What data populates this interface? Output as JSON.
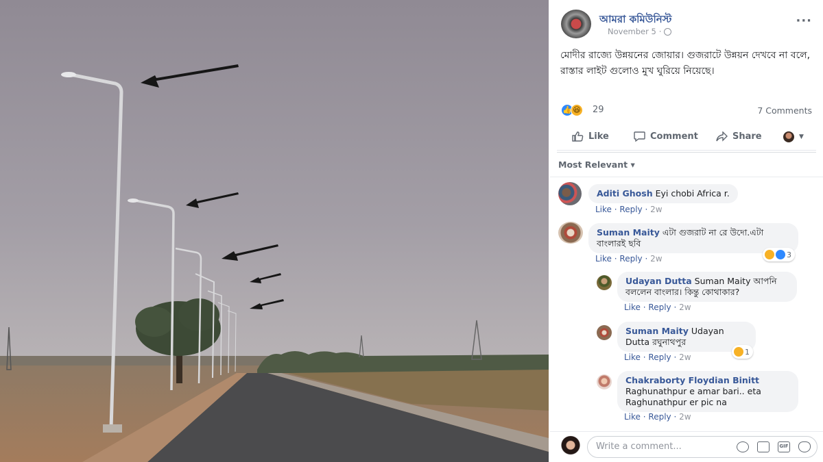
{
  "post": {
    "page_name": "আমরা কমিউনিস্ট",
    "date": "November 5",
    "text": "মোদীর রাজ্যে উন্নয়নের জোয়ার। গুজরাটে উন্নয়ন দেখবে না বলে, রাস্তার লাইট গুলোও মুখ ঘুরিয়ে নিয়েছে।",
    "reaction_count": "29",
    "comments_count": "7 Comments",
    "reaction_types": [
      "like",
      "haha"
    ]
  },
  "actions": {
    "like": "Like",
    "comment": "Comment",
    "share": "Share"
  },
  "filter": {
    "label": "Most Relevant ▾"
  },
  "comments": [
    {
      "author": "Aditi Ghosh",
      "text": "Eyi chobi Africa r.",
      "like": "Like",
      "reply": "Reply",
      "time": "2w"
    },
    {
      "author": "Suman Maity",
      "text": "এটা গুজরাট না রে উদো.এটা বাংলারই ছবি",
      "like": "Like",
      "reply": "Reply",
      "time": "2w",
      "reaction_count": "3"
    },
    {
      "author": "Udayan Dutta",
      "text": "Suman Maity আপনি বললেন বাংলার। কিন্তু কোথাকার?",
      "like": "Like",
      "reply": "Reply",
      "time": "2w"
    },
    {
      "author": "Suman Maity",
      "text": "Udayan Dutta রঘুনাথপুর",
      "like": "Like",
      "reply": "Reply",
      "time": "2w",
      "reaction_count": "1"
    },
    {
      "author": "Chakraborty Floydian Binitt",
      "text": "Raghunathpur e amar bari.. eta Raghunathpur er pic na",
      "like": "Like",
      "reply": "Reply",
      "time": "2w"
    }
  ],
  "composer": {
    "placeholder": "Write a comment..."
  },
  "colors": {
    "link": "#385898",
    "sky": "#8c8590",
    "road": "#4a4a4c",
    "ground": "#9a7a5e",
    "arrow": "#1a1a1a"
  }
}
